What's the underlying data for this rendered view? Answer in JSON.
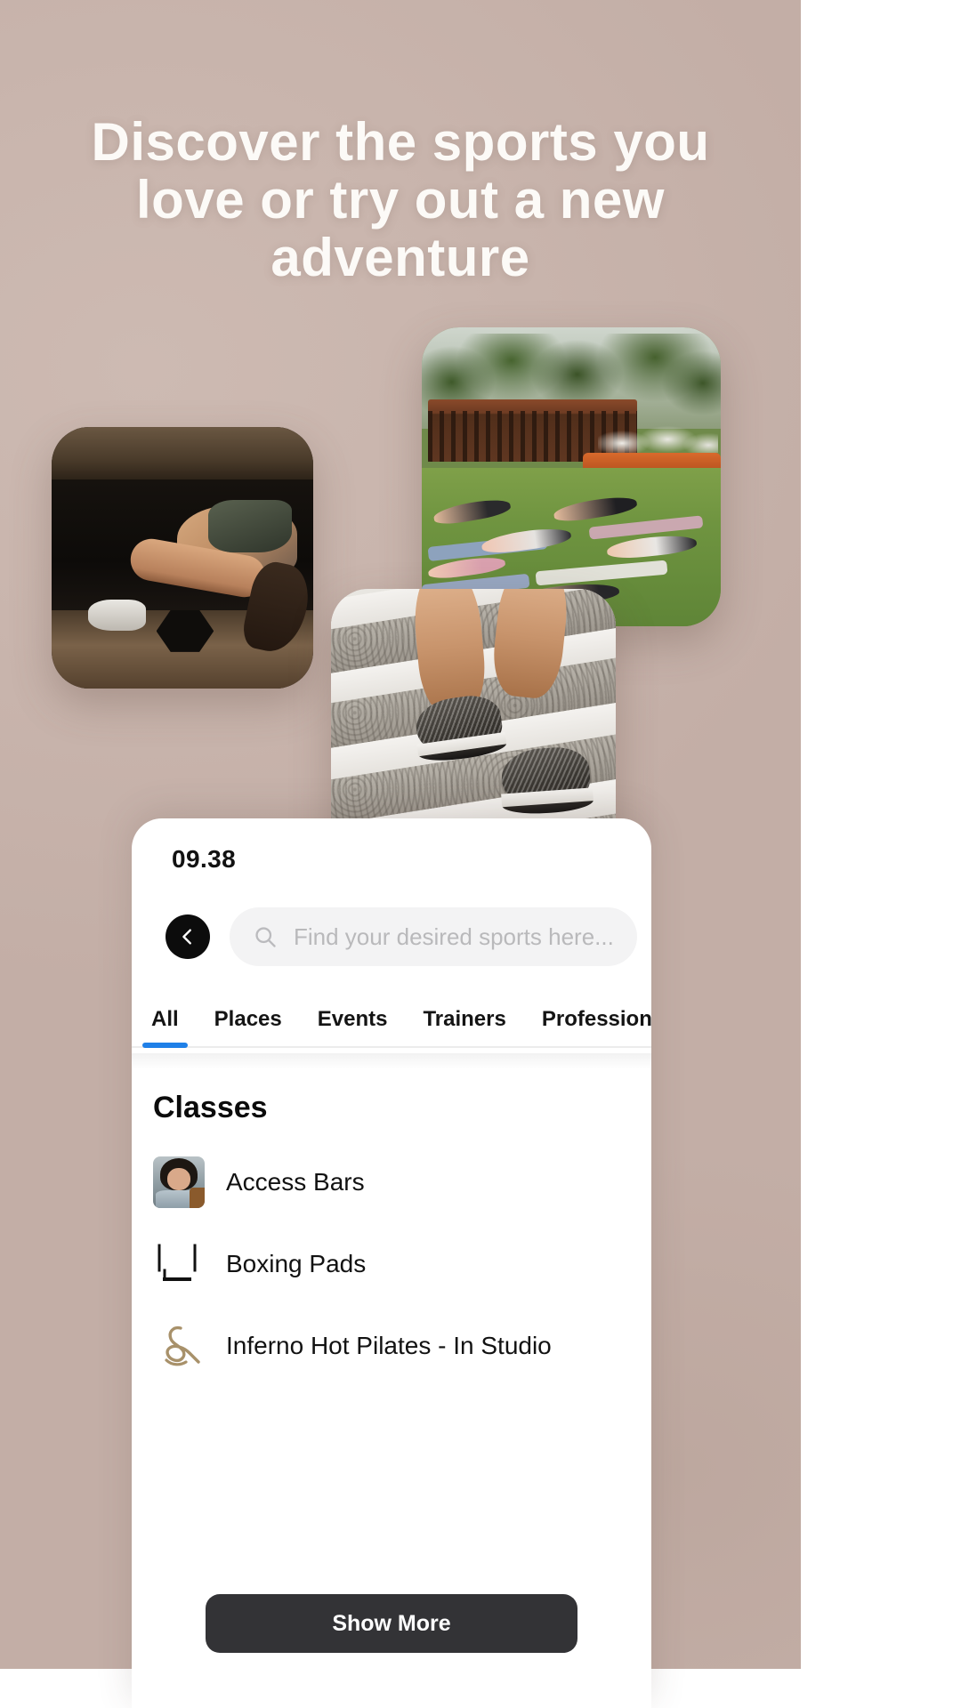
{
  "page": {
    "background_color": "#c9b5ad",
    "headline": "Discover the sports you love or try out a new adventure"
  },
  "photos": [
    {
      "name": "gym-dumbbell-photo",
      "alt": "Woman lifting a dumbbell in a dark gym"
    },
    {
      "name": "outdoor-yoga-photo",
      "alt": "Outdoor yoga class doing plank on grass"
    },
    {
      "name": "stairs-running-photo",
      "alt": "Legs in sneakers running up stone stairs"
    }
  ],
  "app": {
    "status_bar": {
      "time": "09.38"
    },
    "back_button": {
      "icon": "chevron-left-icon",
      "label": "Back"
    },
    "search": {
      "icon": "search-icon",
      "placeholder": "Find your desired sports here...",
      "value": ""
    },
    "tabs": [
      {
        "label": "All",
        "active": true
      },
      {
        "label": "Places",
        "active": false
      },
      {
        "label": "Events",
        "active": false
      },
      {
        "label": "Trainers",
        "active": false
      },
      {
        "label": "Professionals",
        "active": false
      }
    ],
    "active_tab_color": "#1f80e8",
    "section": {
      "title": "Classes",
      "items": [
        {
          "label": "Access Bars",
          "icon": "portrait-avatar-icon"
        },
        {
          "label": "Boxing Pads",
          "icon": "bracket-logo-icon"
        },
        {
          "label": "Inferno Hot Pilates - In Studio",
          "icon": "script-monogram-icon"
        }
      ]
    },
    "show_more_label": "Show More"
  }
}
